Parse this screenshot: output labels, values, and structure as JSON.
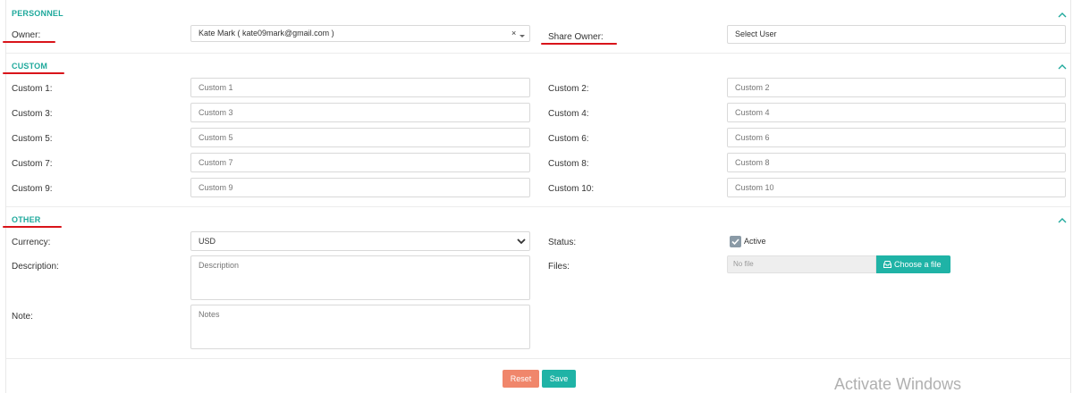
{
  "sections": {
    "personnel": {
      "title": "PERSONNEL",
      "owner_label": "Owner:",
      "owner_value": "Kate Mark ( kate09mark@gmail.com )",
      "owner_clear": "×",
      "share_owner_label": "Share Owner:",
      "share_owner_placeholder": "Select User"
    },
    "custom": {
      "title": "CUSTOM",
      "fields": [
        {
          "label": "Custom 1:",
          "placeholder": "Custom 1"
        },
        {
          "label": "Custom 2:",
          "placeholder": "Custom 2"
        },
        {
          "label": "Custom 3:",
          "placeholder": "Custom 3"
        },
        {
          "label": "Custom 4:",
          "placeholder": "Custom 4"
        },
        {
          "label": "Custom 5:",
          "placeholder": "Custom 5"
        },
        {
          "label": "Custom 6:",
          "placeholder": "Custom 6"
        },
        {
          "label": "Custom 7:",
          "placeholder": "Custom 7"
        },
        {
          "label": "Custom 8:",
          "placeholder": "Custom 8"
        },
        {
          "label": "Custom 9:",
          "placeholder": "Custom 9"
        },
        {
          "label": "Custom 10:",
          "placeholder": "Custom 10"
        }
      ]
    },
    "other": {
      "title": "OTHER",
      "currency_label": "Currency:",
      "currency_value": "USD",
      "status_label": "Status:",
      "status_value": "Active",
      "status_checked": true,
      "description_label": "Description:",
      "description_placeholder": "Description",
      "files_label": "Files:",
      "files_value": "No file",
      "choose_file_label": "Choose a file",
      "note_label": "Note:",
      "note_placeholder": "Notes"
    }
  },
  "actions": {
    "reset_label": "Reset",
    "save_label": "Save",
    "reset_color": "#f0866b",
    "save_color": "#1fb3a6"
  },
  "watermark": "Activate Windows",
  "colors": {
    "accent": "#1fa99c",
    "annotation": "#d9141a"
  }
}
